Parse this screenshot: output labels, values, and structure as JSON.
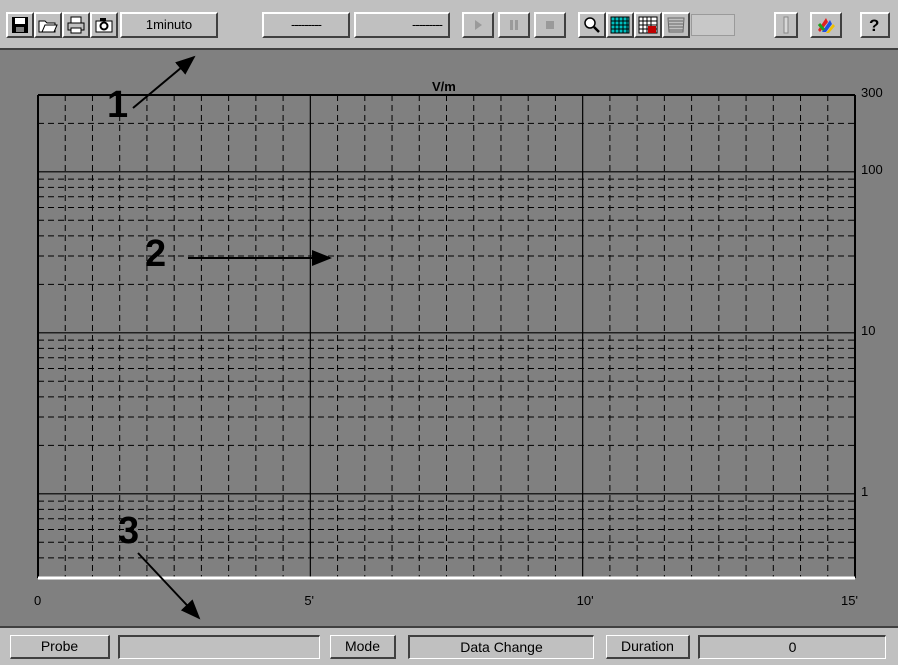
{
  "toolbar": {
    "time_range": "1minuto",
    "field_a": "---------",
    "field_b": "---------"
  },
  "chart_data": {
    "type": "line",
    "title": "V/m",
    "y_scale": "log",
    "y_ticks": [
      {
        "label": "300",
        "value": 300
      },
      {
        "label": "100",
        "value": 100
      },
      {
        "label": "10",
        "value": 10
      },
      {
        "label": "1",
        "value": 1
      }
    ],
    "x_ticks": [
      {
        "label": "0",
        "value": 0
      },
      {
        "label": "5'",
        "value": 5
      },
      {
        "label": "10'",
        "value": 10
      },
      {
        "label": "15'",
        "value": 15
      }
    ],
    "xlim": [
      0,
      15
    ],
    "ylim": [
      0.3,
      300
    ],
    "grid": true,
    "series": []
  },
  "annotations": [
    "1",
    "2",
    "3"
  ],
  "status": {
    "probe_label": "Probe",
    "probe_value": "",
    "mode_label": "Mode",
    "mode_value": "Data Change",
    "duration_label": "Duration",
    "duration_value": "0"
  }
}
